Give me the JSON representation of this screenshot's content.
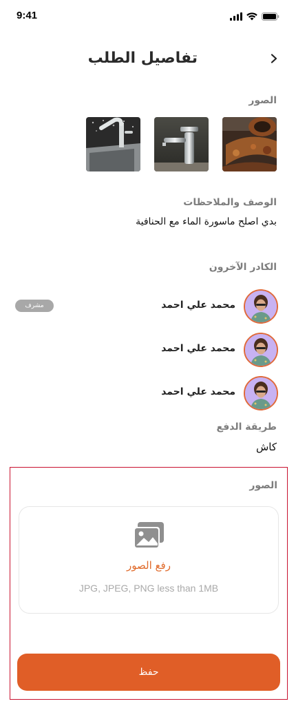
{
  "status_bar": {
    "time": "9:41"
  },
  "header": {
    "title": "تفاصيل الطلب",
    "back_icon": "chevron-right-icon"
  },
  "photos": {
    "label": "الصور",
    "items": [
      {
        "name": "rusty-pipe-photo"
      },
      {
        "name": "faucet-photo"
      },
      {
        "name": "sink-faucet-photo"
      }
    ]
  },
  "description": {
    "label": "الوصف والملاحظات",
    "text": "بدي اصلح ماسورة الماء مع الحنافية"
  },
  "staff": {
    "label": "الكادر الآخرون",
    "members": [
      {
        "name": "محمد علي احمد",
        "badge": "مشرف"
      },
      {
        "name": "محمد علي احمد"
      },
      {
        "name": "محمد علي احمد"
      }
    ]
  },
  "payment": {
    "label": "طريقة الدفع",
    "value": "كاش"
  },
  "upload": {
    "label": "الصور",
    "title": "رفع الصور",
    "hint": "JPG, JPEG, PNG less than 1MB",
    "icon": "image-gallery-icon"
  },
  "save_button": {
    "label": "حفظ"
  },
  "colors": {
    "accent": "#E05E27",
    "avatar_bg": "#C8B2F2",
    "outline": "#C8102E"
  }
}
